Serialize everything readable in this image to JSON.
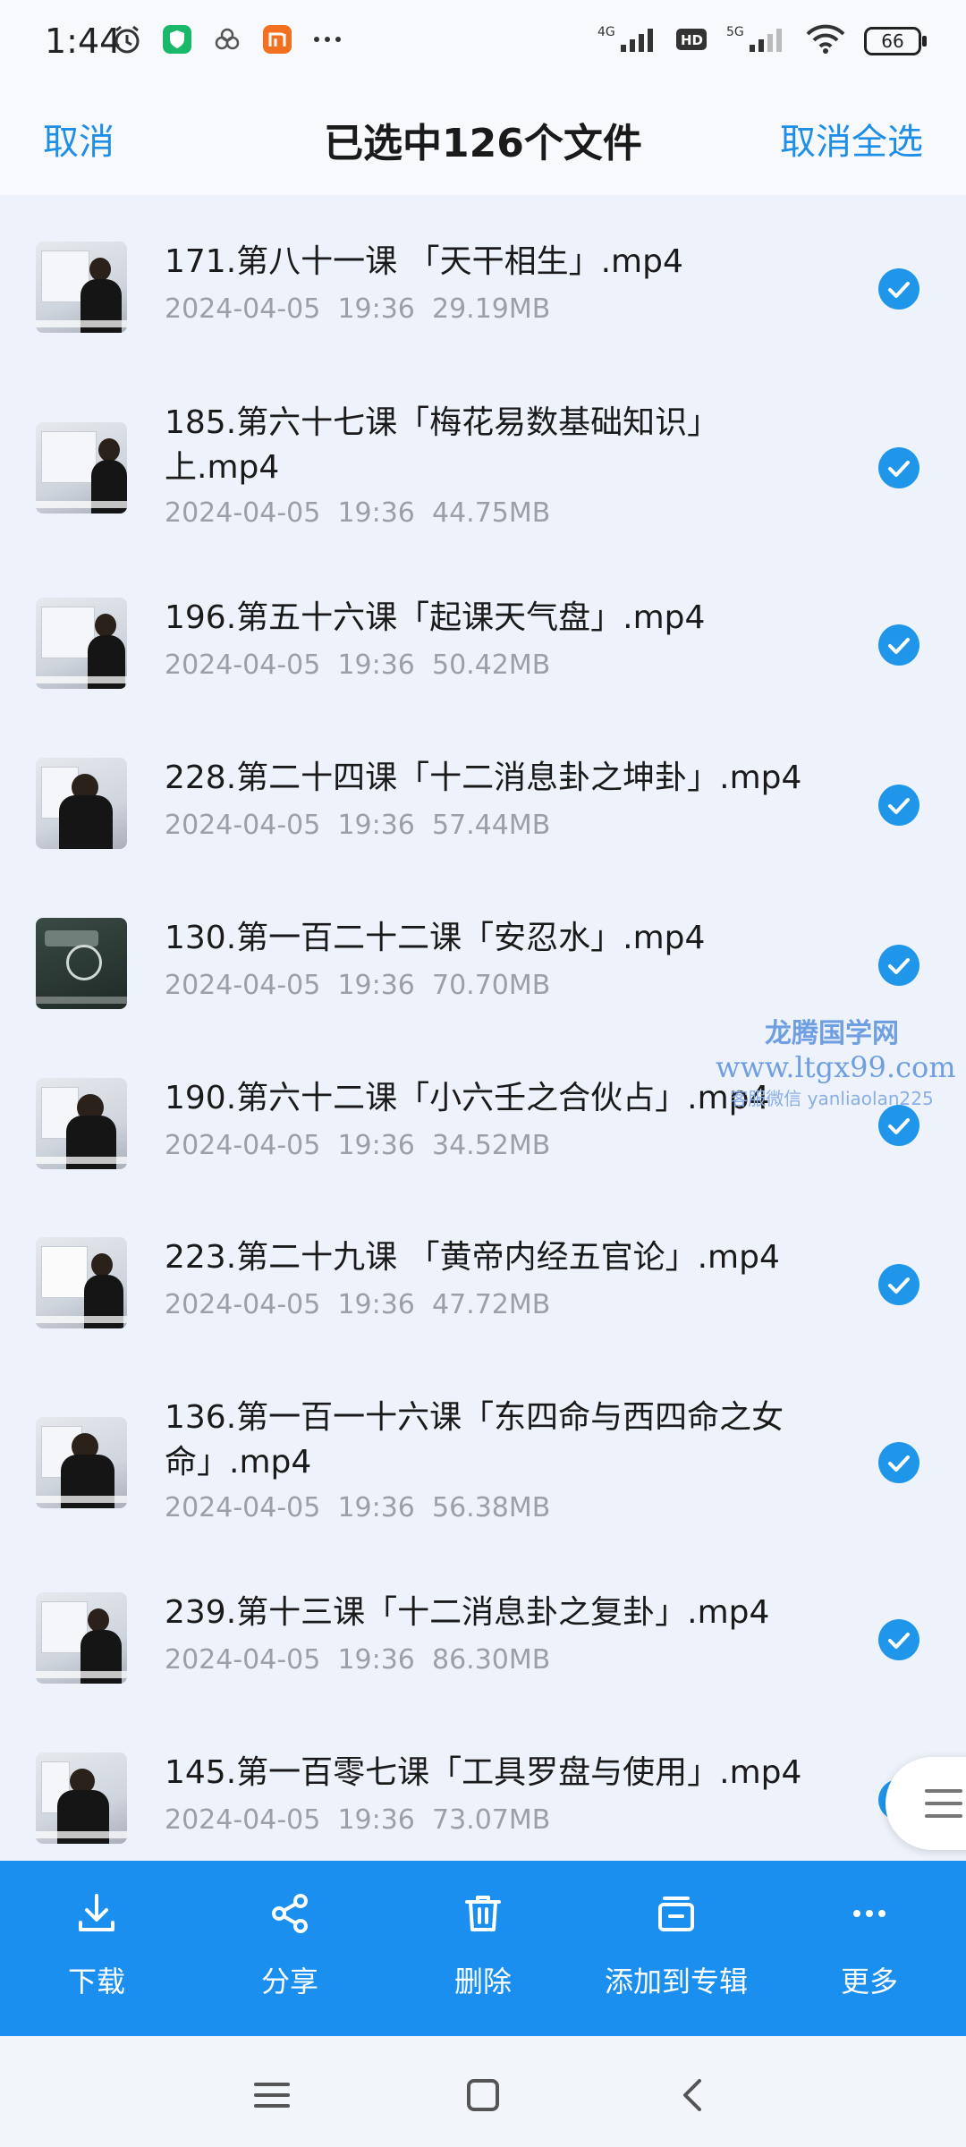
{
  "status_bar": {
    "time": "1:44",
    "battery": "66",
    "network_1": "4G",
    "network_2": "5G",
    "hd": "HD"
  },
  "header": {
    "cancel_label": "取消",
    "title": "已选中126个文件",
    "cancel_all_label": "取消全选"
  },
  "files": [
    {
      "name": "171.第八十一课 「天干相生」.mp4",
      "date": "2024-04-05",
      "time": "19:36",
      "size": "29.19MB",
      "selected": true
    },
    {
      "name": "185.第六十七课「梅花易数基础知识」上.mp4",
      "date": "2024-04-05",
      "time": "19:36",
      "size": "44.75MB",
      "selected": true
    },
    {
      "name": "196.第五十六课「起课天气盘」.mp4",
      "date": "2024-04-05",
      "time": "19:36",
      "size": "50.42MB",
      "selected": true
    },
    {
      "name": "228.第二十四课「十二消息卦之坤卦」.mp4",
      "date": "2024-04-05",
      "time": "19:36",
      "size": "57.44MB",
      "selected": true
    },
    {
      "name": "130.第一百二十二课「安忍水」.mp4",
      "date": "2024-04-05",
      "time": "19:36",
      "size": "70.70MB",
      "selected": true
    },
    {
      "name": "190.第六十二课「小六壬之合伙占」.mp4",
      "date": "2024-04-05",
      "time": "19:36",
      "size": "34.52MB",
      "selected": true
    },
    {
      "name": "223.第二十九课 「黄帝内经五官论」.mp4",
      "date": "2024-04-05",
      "time": "19:36",
      "size": "47.72MB",
      "selected": true
    },
    {
      "name": "136.第一百一十六课「东四命与西四命之女命」.mp4",
      "date": "2024-04-05",
      "time": "19:36",
      "size": "56.38MB",
      "selected": true
    },
    {
      "name": "239.第十三课「十二消息卦之复卦」.mp4",
      "date": "2024-04-05",
      "time": "19:36",
      "size": "86.30MB",
      "selected": true
    },
    {
      "name": "145.第一百零七课「工具罗盘与使用」.mp4",
      "date": "2024-04-05",
      "time": "19:36",
      "size": "73.07MB",
      "selected": true
    }
  ],
  "watermark": {
    "title": "龙腾国学网",
    "url": "www.ltgx99.com",
    "contact": "客服微信 yanliaolan225"
  },
  "actions": [
    {
      "label": "下载",
      "icon": "download-icon"
    },
    {
      "label": "分享",
      "icon": "share-icon"
    },
    {
      "label": "删除",
      "icon": "trash-icon"
    },
    {
      "label": "添加到专辑",
      "icon": "album-add-icon"
    },
    {
      "label": "更多",
      "icon": "more-icon"
    }
  ],
  "colors": {
    "accent": "#1f8ee6",
    "action_bar": "#1a8ff0",
    "check": "#1f96ea"
  }
}
